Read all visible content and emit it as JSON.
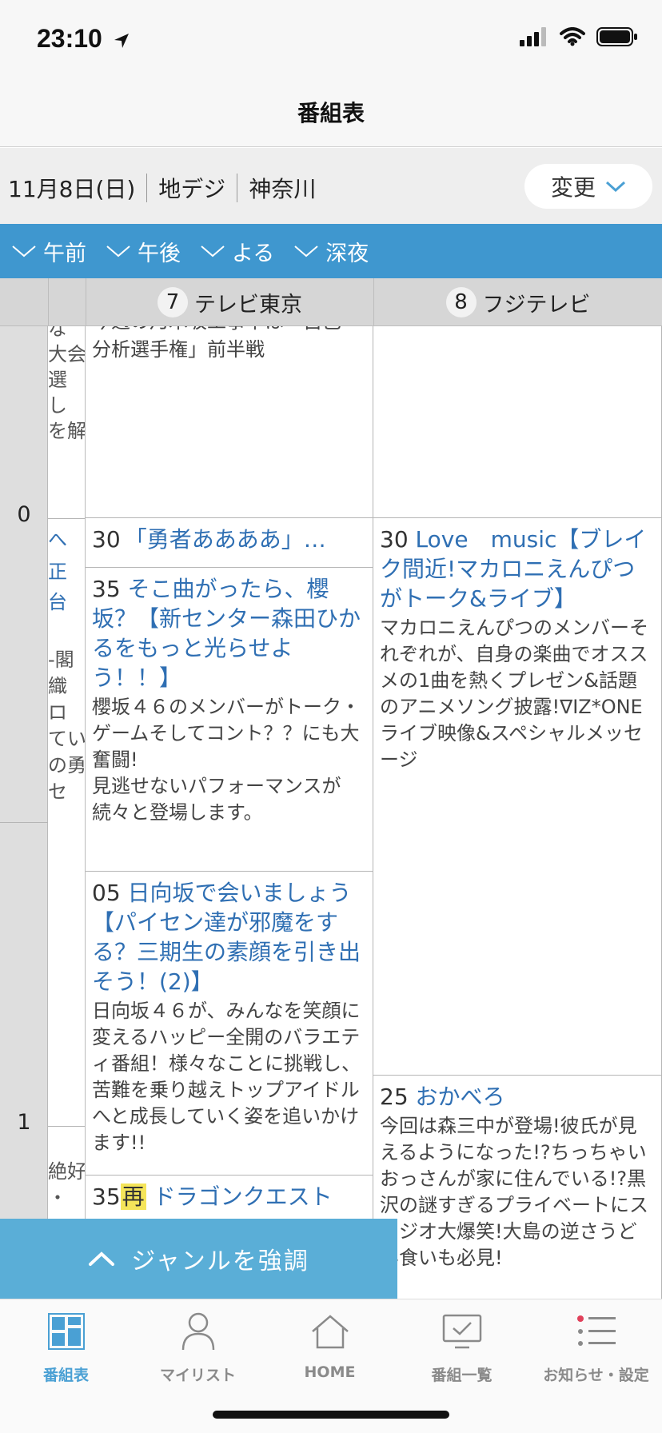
{
  "status": {
    "time": "23:10"
  },
  "nav": {
    "title": "番組表"
  },
  "info": {
    "date": "11月8日(日)",
    "broadcast": "地デジ",
    "region": "神奈川",
    "change_label": "変更"
  },
  "time_tabs": [
    "午前",
    "午後",
    "よる",
    "深夜"
  ],
  "channels": [
    {
      "num": "7",
      "name": "テレビ東京"
    },
    {
      "num": "8",
      "name": "フジテレビ"
    }
  ],
  "hours": [
    "0",
    "1"
  ],
  "prev_column": {
    "lines_top": [
      "な",
      "大会",
      "選",
      "し",
      "を解"
    ],
    "lines_mid": [
      "へ",
      "正",
      "台",
      "",
      "-閣",
      "織",
      "ロ",
      "てい",
      "の勇",
      "セ"
    ],
    "lines_bottom": [
      "絶好",
      "・"
    ]
  },
  "tv_tokyo": {
    "p1": {
      "text_top": "今週の乃木坂工事中は「自己",
      "text": "分析選手権」前半戦"
    },
    "p2": {
      "time": "30",
      "title": "「勇者ああああ」…"
    },
    "p3": {
      "time": "35",
      "title": "そこ曲がったら、櫻坂？【新センター森田ひかるをもっと光らせよう！！】",
      "desc": "櫻坂４６のメンバーがトーク・ゲームそしてコント？？にも大奮闘!\n見逃せないパフォーマンスが続々と登場します。"
    },
    "p4": {
      "time": "05",
      "title": "日向坂で会いましょう【パイセン達が邪魔をする？三期生の素顔を引き出そう！(2)】",
      "desc": "日向坂４６が、みんなを笑顔に変えるハッピー全開のバラエティ番組！様々なことに挑戦し、苦難を乗り越えトップアイドルへと成長していく姿を追いかけます!!"
    },
    "p5": {
      "time": "35",
      "rerun": "再",
      "title": "ドラゴンクエスト"
    }
  },
  "fuji": {
    "p1": {
      "time": "30",
      "title": "Love　music【ブレイク間近!マカロニえんぴつがトーク&ライブ】",
      "desc": "マカロニえんぴつのメンバーそれぞれが、自身の楽曲でオススメの1曲を熱くプレゼン&話題のアニメソング披露!∇IZ*ONEライブ映像&スペシャルメッセージ"
    },
    "p2": {
      "time": "25",
      "title": "おかべろ",
      "desc": "今回は森三中が登場!彼氏が見えるようになった!?ちっちゃいおっさんが家に住んでいる!?黒沢の謎すぎるプライベートにスタジオ大爆笑!大島の逆さうどん食いも必見!"
    }
  },
  "genre": {
    "label": "ジャンルを強調"
  },
  "tabs": [
    {
      "label": "番組表",
      "icon": "grid-icon",
      "active": true
    },
    {
      "label": "マイリスト",
      "icon": "person-icon"
    },
    {
      "label": "HOME",
      "icon": "home-icon"
    },
    {
      "label": "番組一覧",
      "icon": "tv-check-icon"
    },
    {
      "label": "お知らせ・設定",
      "icon": "list-icon"
    }
  ],
  "colors": {
    "accent": "#3f97cf",
    "link": "#2f6fb3",
    "genre": "#5aaed7",
    "rerun": "#f5e55a"
  }
}
